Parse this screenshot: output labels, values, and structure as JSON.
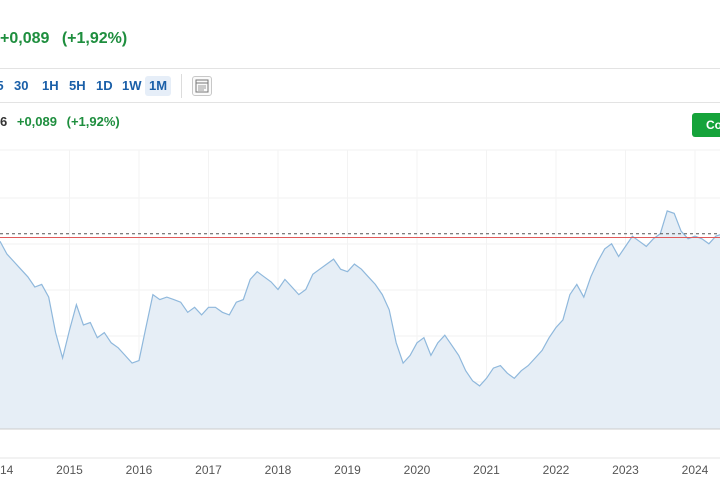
{
  "header": {
    "change": "+0,089",
    "change_pct": "(+1,92%)"
  },
  "toolbar": {
    "timeframes": [
      "5",
      "30",
      "1H",
      "5H",
      "1D",
      "1W",
      "1M"
    ],
    "active_timeframe": "1M",
    "chart_type_icon": "chart-settings-icon"
  },
  "legend": {
    "change": "+0,089",
    "change_pct": "(+1,92%)",
    "price_fragment": "6"
  },
  "compare_button": {
    "label": "Co"
  },
  "colors": {
    "positive": "#1e8e3e",
    "line": "#8fb8dc",
    "area": "#e6eef6",
    "ref_line_red": "#e05a5a",
    "ref_line_dash": "#555555",
    "compare_bg": "#15a33a",
    "timeframe_text": "#1a5fa8"
  },
  "chart_data": {
    "type": "area",
    "x_tick_labels": [
      "14",
      "2015",
      "2016",
      "2017",
      "2018",
      "2019",
      "2020",
      "2021",
      "2022",
      "2023",
      "2024"
    ],
    "x": [
      2014.0,
      2014.1,
      2014.2,
      2014.3,
      2014.4,
      2014.5,
      2014.6,
      2014.7,
      2014.8,
      2014.9,
      2015.0,
      2015.1,
      2015.2,
      2015.3,
      2015.4,
      2015.5,
      2015.6,
      2015.7,
      2015.8,
      2015.9,
      2016.0,
      2016.1,
      2016.2,
      2016.3,
      2016.4,
      2016.5,
      2016.6,
      2016.7,
      2016.8,
      2016.9,
      2017.0,
      2017.1,
      2017.2,
      2017.3,
      2017.4,
      2017.5,
      2017.6,
      2017.7,
      2017.8,
      2017.9,
      2018.0,
      2018.1,
      2018.2,
      2018.3,
      2018.4,
      2018.5,
      2018.6,
      2018.7,
      2018.8,
      2018.9,
      2019.0,
      2019.1,
      2019.2,
      2019.3,
      2019.4,
      2019.5,
      2019.6,
      2019.7,
      2019.8,
      2019.9,
      2020.0,
      2020.1,
      2020.2,
      2020.3,
      2020.4,
      2020.5,
      2020.6,
      2020.7,
      2020.8,
      2020.9,
      2021.0,
      2021.1,
      2021.2,
      2021.3,
      2021.4,
      2021.5,
      2021.6,
      2021.7,
      2021.8,
      2021.9,
      2022.0,
      2022.1,
      2022.2,
      2022.3,
      2022.4,
      2022.5,
      2022.6,
      2022.7,
      2022.8,
      2022.9,
      2023.0,
      2023.1,
      2023.2,
      2023.3,
      2023.4,
      2023.5,
      2023.6,
      2023.7,
      2023.8,
      2023.9,
      2024.0,
      2024.1,
      2024.2,
      2024.3,
      2024.4
    ],
    "y": [
      8.4,
      7.9,
      7.6,
      7.3,
      7.0,
      6.6,
      6.7,
      6.2,
      4.8,
      3.8,
      4.9,
      5.9,
      5.1,
      5.2,
      4.6,
      4.8,
      4.4,
      4.2,
      3.9,
      3.6,
      3.7,
      5.0,
      6.3,
      6.1,
      6.2,
      6.1,
      6.0,
      5.6,
      5.8,
      5.5,
      5.8,
      5.8,
      5.6,
      5.5,
      6.0,
      6.1,
      6.9,
      7.2,
      7.0,
      6.8,
      6.5,
      6.9,
      6.6,
      6.3,
      6.5,
      7.1,
      7.3,
      7.5,
      7.7,
      7.3,
      7.2,
      7.5,
      7.3,
      7.0,
      6.7,
      6.3,
      5.7,
      4.4,
      3.6,
      3.9,
      4.4,
      4.6,
      3.9,
      4.4,
      4.7,
      4.3,
      3.9,
      3.3,
      2.9,
      2.7,
      3.0,
      3.4,
      3.5,
      3.2,
      3.0,
      3.3,
      3.5,
      3.8,
      4.1,
      4.6,
      5.0,
      5.3,
      6.3,
      6.7,
      6.2,
      7.0,
      7.6,
      8.1,
      8.3,
      7.8,
      8.2,
      8.6,
      8.4,
      8.2,
      8.5,
      8.7,
      9.6,
      9.5,
      8.8,
      8.5,
      8.6,
      8.5,
      8.3,
      8.6,
      8.7
    ],
    "ylim": [
      1.0,
      12.0
    ],
    "reference_lines": [
      8.7,
      8.55
    ],
    "grid": true
  }
}
